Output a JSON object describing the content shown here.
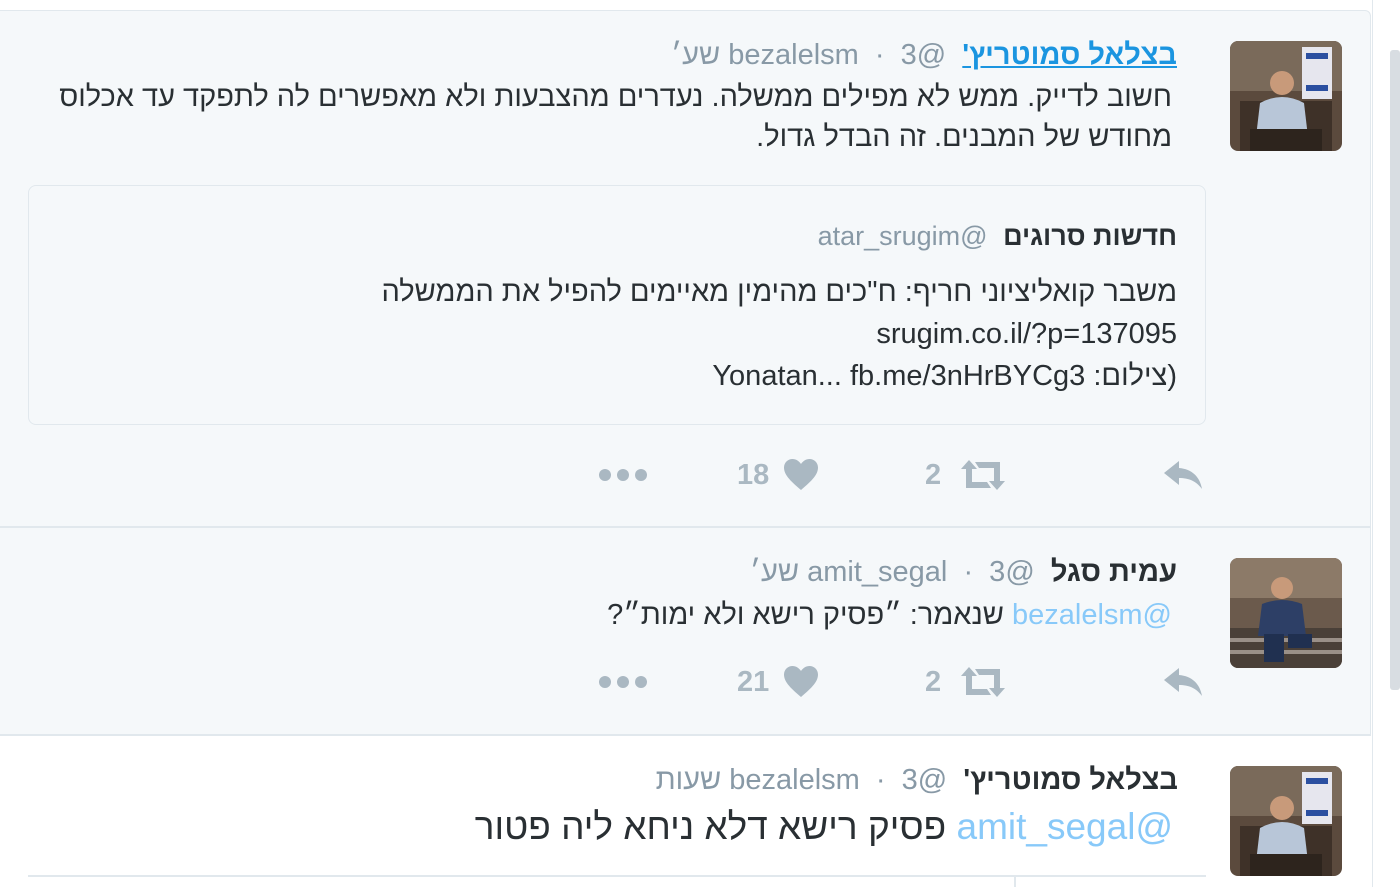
{
  "tweets": [
    {
      "fullname": "בצלאל סמוטריץ'",
      "handle": "@bezalelsm",
      "separator": "·",
      "time": "3 שע׳",
      "text_lines": [
        "חשוב לדייק. ממש לא מפילים ממשלה. נעדרים מהצבעות ולא מאפשרים לה לתפקד עד אכלוס",
        "מחודש של המבנים. זה הבדל גדול."
      ],
      "quote": {
        "name": "חדשות סרוגים",
        "handle": "@atar_srugim",
        "line1": "משבר קואליציוני חריף: ח\"כים מהימין מאיימים להפיל את הממשלה",
        "line2": "srugim.co.il/?p=137095",
        "line3": "(צילום: Yonatan... fb.me/3nHrBYCg3"
      },
      "retweets": "2",
      "likes": "18"
    },
    {
      "fullname": "עמית סגל",
      "handle": "@amit_segal",
      "separator": "·",
      "time": "3 שע׳",
      "mention": "@bezalelsm",
      "text": "שנאמר: ״פסיק רישא ולא ימות״?",
      "retweets": "2",
      "likes": "21"
    },
    {
      "fullname": "בצלאל סמוטריץ'",
      "handle": "@bezalelsm",
      "separator": "·",
      "time": "3 שעות",
      "mention": "@amit_segal",
      "text": "פסיק רישא דלא ניחא ליה פטור"
    }
  ],
  "icons": {
    "reply": "reply-icon",
    "retweet": "retweet-icon",
    "like": "heart-icon",
    "more": "more-dots-icon"
  },
  "colors": {
    "link": "#1b95e0",
    "mention": "#88c9f9",
    "muted": "#8899a6",
    "action": "#aab8c2",
    "text": "#292f33",
    "tweet_bg": "#f5f8fa"
  }
}
